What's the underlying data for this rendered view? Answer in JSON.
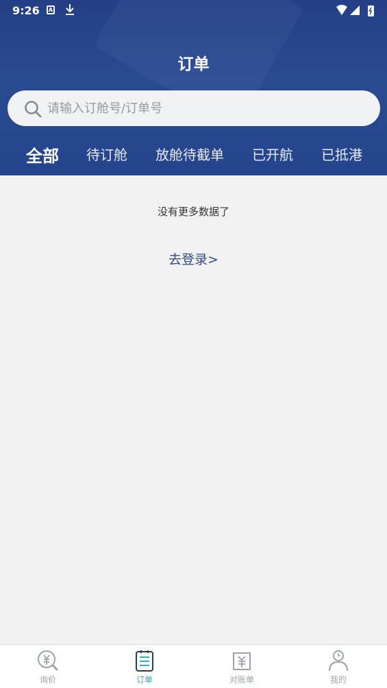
{
  "status_bar": {
    "time": "9:26"
  },
  "header": {
    "title": "订单"
  },
  "search": {
    "placeholder": "请输入订舱号/订单号"
  },
  "tabs": [
    {
      "label": "全部"
    },
    {
      "label": "待订舱"
    },
    {
      "label": "放舱待截单"
    },
    {
      "label": "已开航"
    },
    {
      "label": "已抵港"
    }
  ],
  "content": {
    "no_more_text": "没有更多数据了",
    "login_link": "去登录>"
  },
  "bottom_nav": [
    {
      "label": "询价",
      "icon": "quote-icon"
    },
    {
      "label": "订单",
      "icon": "orders-icon"
    },
    {
      "label": "对账单",
      "icon": "statement-icon"
    },
    {
      "label": "我的",
      "icon": "profile-icon"
    }
  ],
  "colors": {
    "header_bg": "#24448c",
    "accent_active": "#3aa8c0",
    "link": "#2c4a8c",
    "page_bg": "#f2f2f2"
  }
}
